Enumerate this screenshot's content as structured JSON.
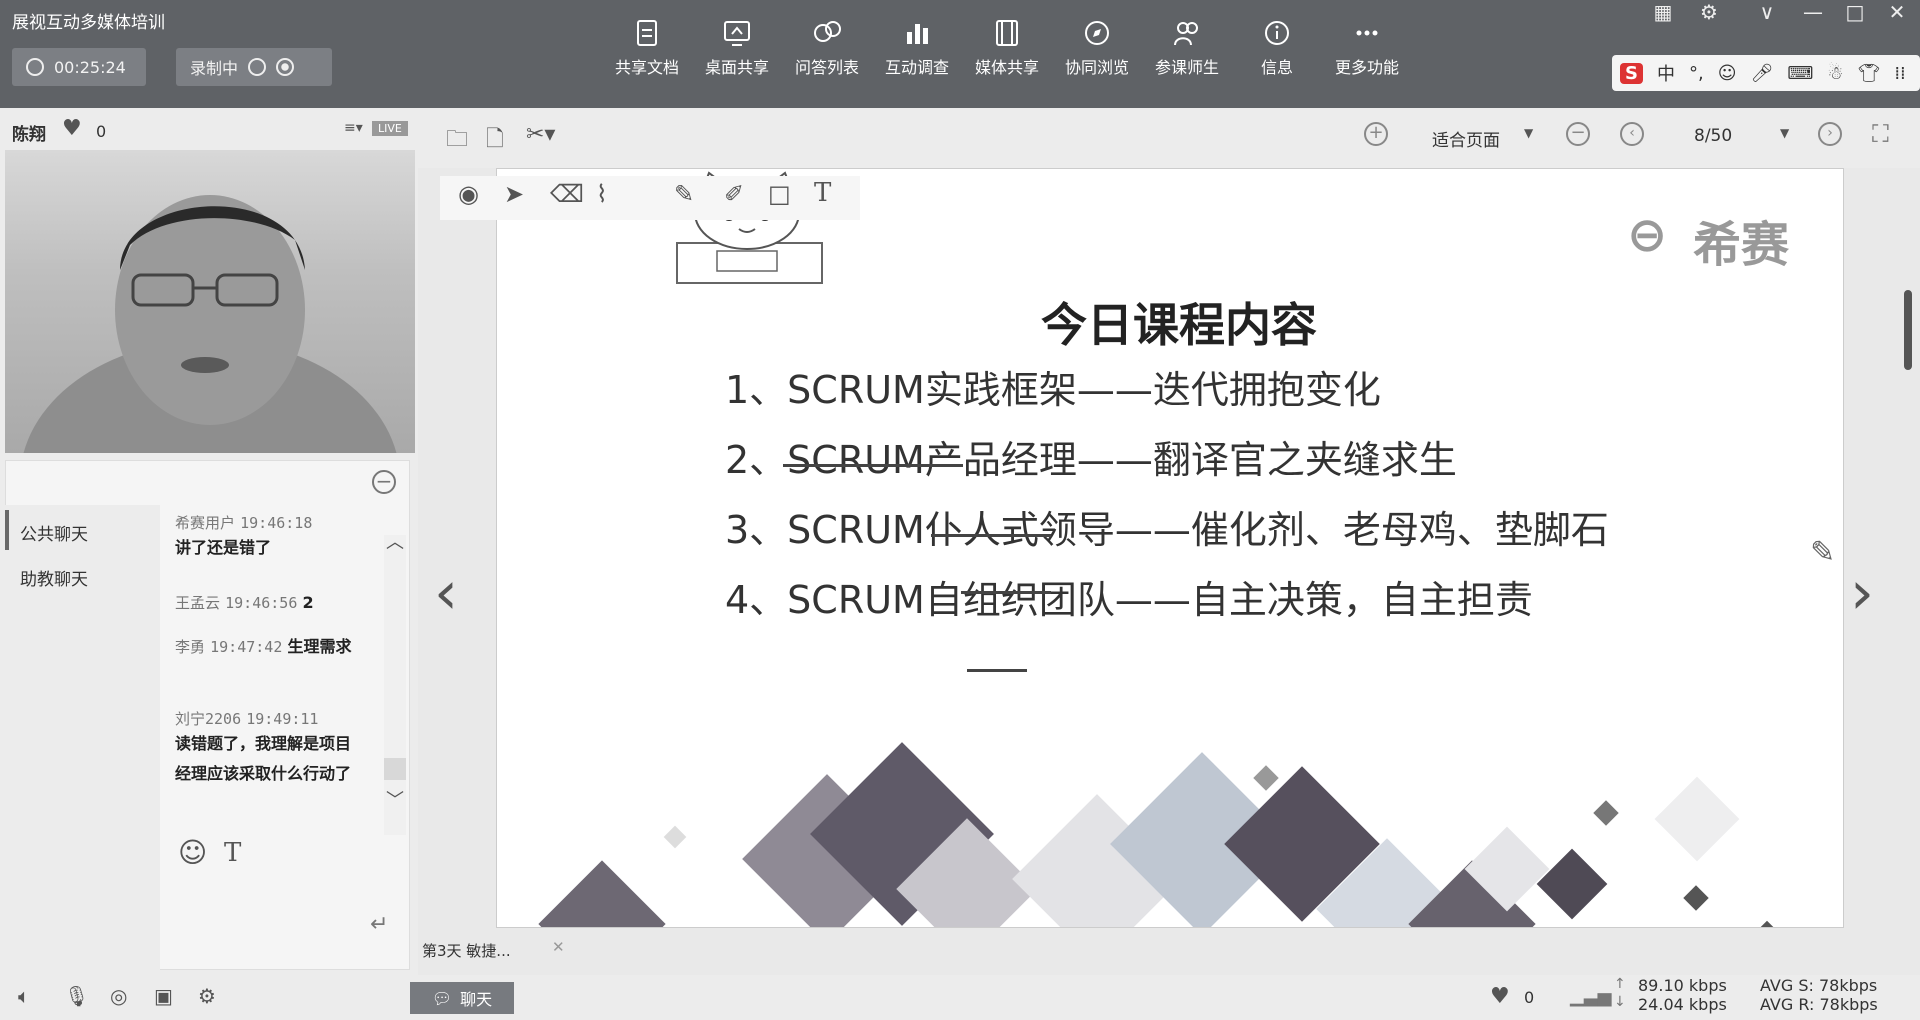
{
  "app": {
    "title": "展视互动多媒体培训",
    "timer": "00:25:24",
    "recording": "录制中"
  },
  "toolbar": {
    "items": [
      {
        "label": "共享文档",
        "icon": "document-icon"
      },
      {
        "label": "桌面共享",
        "icon": "desktop-share-icon"
      },
      {
        "label": "问答列表",
        "icon": "qa-icon"
      },
      {
        "label": "互动调查",
        "icon": "survey-chart-icon"
      },
      {
        "label": "媒体共享",
        "icon": "film-icon"
      },
      {
        "label": "协同浏览",
        "icon": "compass-icon"
      },
      {
        "label": "参课师生",
        "icon": "people-icon"
      },
      {
        "label": "信息",
        "icon": "info-icon"
      },
      {
        "label": "更多功能",
        "icon": "more-icon"
      }
    ]
  },
  "ime": {
    "label": "中"
  },
  "user": {
    "name": "陈翔",
    "likes": "0",
    "live": "LIVE"
  },
  "chat": {
    "tabs": [
      "公共聊天",
      "助教聊天"
    ],
    "messages": [
      {
        "user": "希赛用户",
        "time": "19:46:18",
        "text": "讲了还是错了"
      },
      {
        "user": "王孟云",
        "time": "19:46:56",
        "text": "2"
      },
      {
        "user": "李勇",
        "time": "19:47:42",
        "text": "生理需求"
      },
      {
        "user": "刘宁2206",
        "time": "19:49:11",
        "text": "读错题了，我理解是项目经理应该采取什么行动了"
      }
    ],
    "font_icon": "T"
  },
  "docview": {
    "zoom": "适合页面",
    "page": "8/50",
    "tab": "第3天 敏捷..."
  },
  "slide": {
    "brand": "希赛",
    "title": "今日课程内容",
    "items": [
      "1、SCRUM实践框架——迭代拥抱变化",
      "2、SCRUM产品经理——翻译官之夹缝求生",
      "3、SCRUM仆人式领导——催化剂、老母鸡、垫脚石",
      "4、SCRUM自组织团队——自主决策，自主担责"
    ]
  },
  "status": {
    "chat_button": "聊天",
    "likes": "0",
    "up": "89.10 kbps",
    "down": "24.04 kbps",
    "avg_s": "AVG S: 78kbps",
    "avg_r": "AVG R: 78kbps"
  }
}
